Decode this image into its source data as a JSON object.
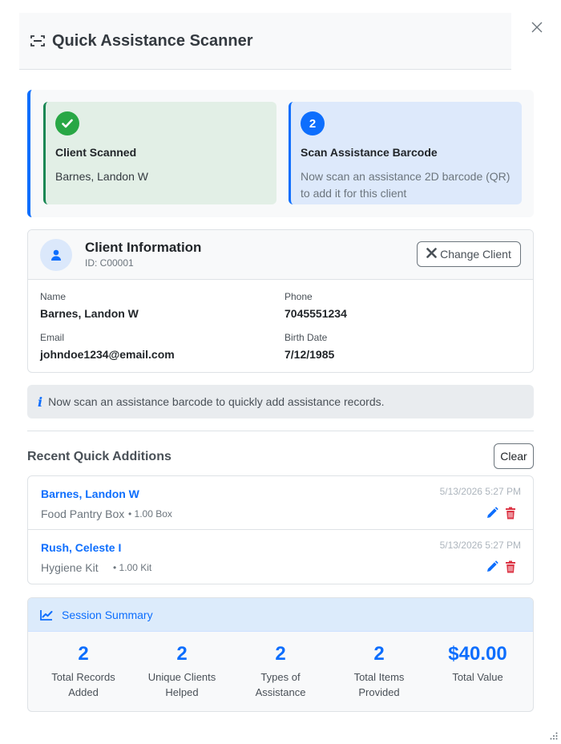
{
  "header": {
    "title": "Quick Assistance Scanner"
  },
  "steps": [
    {
      "badge": "",
      "title": "Client Scanned",
      "body": "Barnes, Landon W",
      "state": "done"
    },
    {
      "badge": "2",
      "title": "Scan Assistance Barcode",
      "body": "Now scan an assistance 2D barcode (QR) to add it for this client",
      "state": "active"
    }
  ],
  "client": {
    "title": "Client Information",
    "id_text": "ID: C00001",
    "change_label": "Change Client",
    "fields": {
      "name_label": "Name",
      "name": "Barnes, Landon W",
      "phone_label": "Phone",
      "phone": "7045551234",
      "email_label": "Email",
      "email": "johndoe1234@email.com",
      "birth_label": "Birth Date",
      "birth": "7/12/1985"
    }
  },
  "info": {
    "text": "Now scan an assistance barcode to quickly add assistance records."
  },
  "recent": {
    "title": "Recent Quick Additions",
    "clear_label": "Clear",
    "items": [
      {
        "name": "Barnes, Landon W",
        "time": "5/13/2026 5:27 PM",
        "type": "Food Pantry Box",
        "qty": "1.00 Box"
      },
      {
        "name": "Rush, Celeste I",
        "time": "5/13/2026 5:27 PM",
        "type": "Hygiene Kit",
        "qty": "1.00 Kit"
      }
    ]
  },
  "summary": {
    "title": "Session Summary",
    "stats": [
      {
        "value": "2",
        "line1": "Total Records",
        "line2": "Added"
      },
      {
        "value": "2",
        "line1": "Unique Clients",
        "line2": "Helped"
      },
      {
        "value": "2",
        "line1": "Types of",
        "line2": "Assistance"
      },
      {
        "value": "2",
        "line1": "Total Items",
        "line2": "Provided"
      },
      {
        "value": "$40.00",
        "line1": "Total Value",
        "line2": ""
      }
    ]
  },
  "colors": {
    "accent": "#0d6efd",
    "success": "#28a745",
    "danger": "#dc3545"
  }
}
